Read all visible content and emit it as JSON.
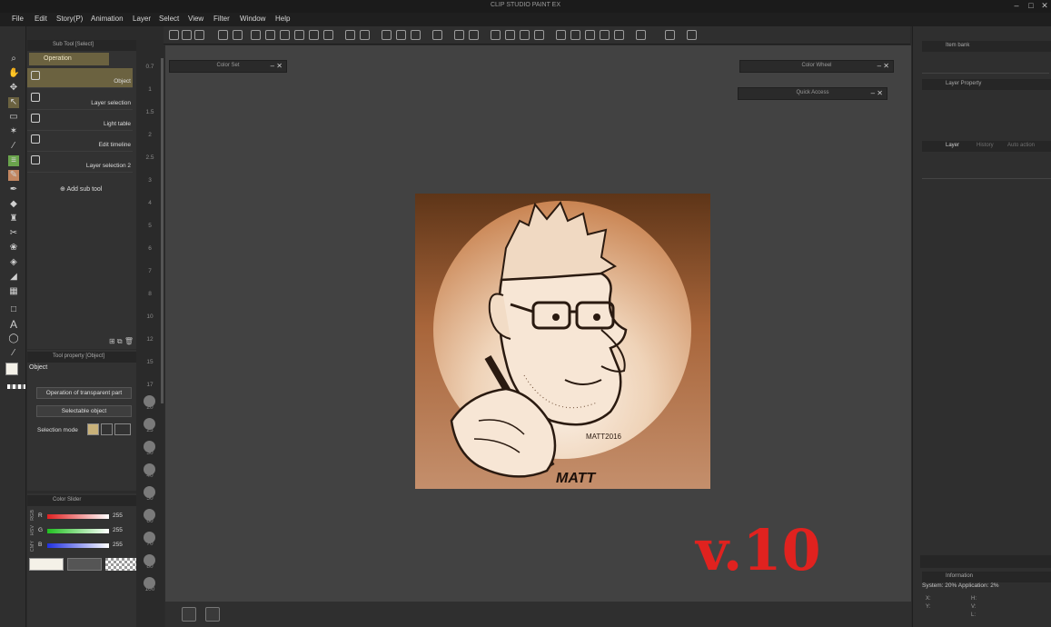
{
  "app": {
    "title": "CLIP STUDIO PAINT EX"
  },
  "menu": [
    {
      "label": "File"
    },
    {
      "label": "Edit"
    },
    {
      "label": "Story(P)"
    },
    {
      "label": "Animation"
    },
    {
      "label": "Layer"
    },
    {
      "label": "Select"
    },
    {
      "label": "View"
    },
    {
      "label": "Filter"
    },
    {
      "label": "Window"
    },
    {
      "label": "Help"
    }
  ],
  "subtool": {
    "header": "Sub Tool [Select]",
    "group_tab": "Operation",
    "items": [
      {
        "label": "Object",
        "icon": "select-object-icon",
        "selected": true
      },
      {
        "label": "Layer selection",
        "icon": "layer-select-icon"
      },
      {
        "label": "Light table",
        "icon": "light-table-icon"
      },
      {
        "label": "Edit timeline",
        "icon": "timeline-icon"
      },
      {
        "label": "Layer selection 2",
        "icon": "layer-select-icon"
      }
    ],
    "add_label": "Add sub tool"
  },
  "tool_property": {
    "header": "Tool property [Object]",
    "title": "Object",
    "operation_transparent": "Operation of transparent part",
    "selectable_object": "Selectable object",
    "selection_mode_label": "Selection mode"
  },
  "color_slider": {
    "header": "Color Slider",
    "modes": [
      "RGB",
      "HSV",
      "CMY"
    ],
    "channels": [
      {
        "name": "R",
        "value": "255",
        "color": "#e02020"
      },
      {
        "name": "G",
        "value": "255",
        "color": "#20c020"
      },
      {
        "name": "B",
        "value": "255",
        "color": "#2030e0"
      }
    ]
  },
  "floating_panels": {
    "color_set": "Color Set",
    "color_wheel": "Color Wheel",
    "quick_access": "Quick Access"
  },
  "ruler": [
    "0.7",
    "1",
    "1.5",
    "2",
    "2.5",
    "3",
    "4",
    "5",
    "6",
    "7",
    "8",
    "10",
    "12",
    "15",
    "17",
    "20",
    "25",
    "30",
    "40",
    "50",
    "60",
    "70",
    "80",
    "100"
  ],
  "right_panel": {
    "item_bank": "Item bank",
    "layer_property": "Layer Property",
    "layer_tab": "Layer",
    "history_tab": "History",
    "auto_action_tab": "Auto action",
    "information_tab": "Information",
    "system_label": "System:",
    "system_value": "20%",
    "application_label": "Application:",
    "application_value": "2%",
    "info_x": "X:",
    "info_y": "Y:",
    "info_h": "H:",
    "info_v": "V:",
    "info_l": "L:"
  },
  "artwork": {
    "signature": "MATT",
    "date_text": "MATT2016",
    "background_color": "#b77a52",
    "circle_color": "#f3e4d4"
  },
  "overlay": {
    "version": "v.10"
  }
}
